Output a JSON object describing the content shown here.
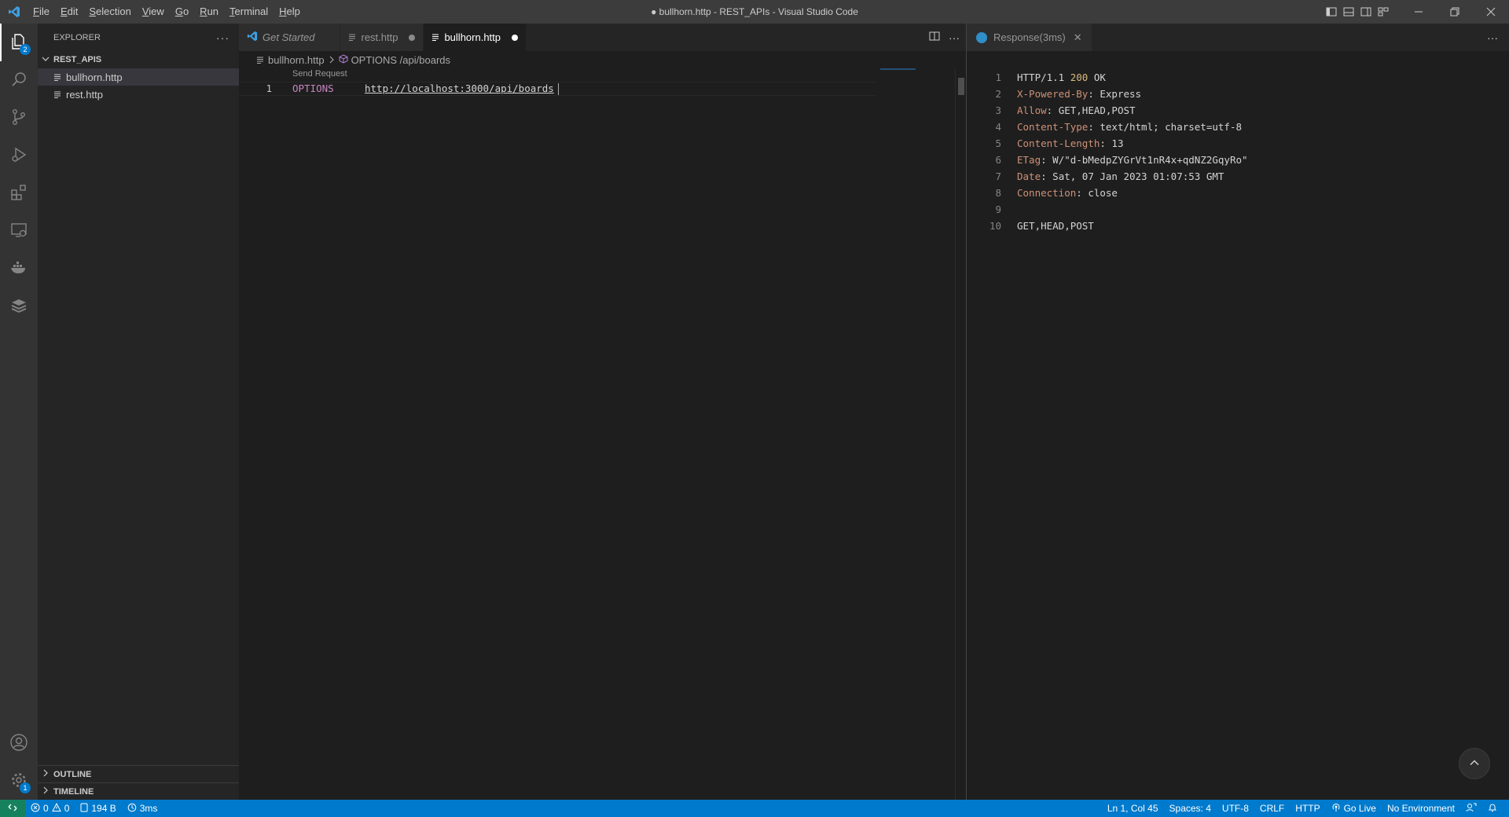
{
  "window": {
    "title": "● bullhorn.http - REST_APIs - Visual Studio Code"
  },
  "menu": [
    "File",
    "Edit",
    "Selection",
    "View",
    "Go",
    "Run",
    "Terminal",
    "Help"
  ],
  "activity": {
    "explorer_badge": "2",
    "settings_badge": "1"
  },
  "sidebar": {
    "header": "EXPLORER",
    "more": "···",
    "folder": "REST_APIS",
    "files": [
      {
        "name": "bullhorn.http",
        "selected": true
      },
      {
        "name": "rest.http",
        "selected": false
      }
    ],
    "outline": "OUTLINE",
    "timeline": "TIMELINE"
  },
  "editor": {
    "tabs": [
      {
        "label": "Get Started",
        "italic": true
      },
      {
        "label": "rest.http",
        "dirty": true
      },
      {
        "label": "bullhorn.http",
        "dirty": true,
        "active": true
      }
    ],
    "breadcrumb": {
      "file": "bullhorn.http",
      "symbol": "OPTIONS /api/boards"
    },
    "codelens": "Send Request",
    "line_number": "1",
    "method": "OPTIONS",
    "url": "http://localhost:3000/api/boards"
  },
  "response": {
    "tab_label": "Response(3ms)",
    "lines": [
      {
        "n": "1",
        "key": "HTTP/1.1 ",
        "status": "200",
        "rest": " OK"
      },
      {
        "n": "2",
        "key": "X-Powered-By",
        "value": "Express"
      },
      {
        "n": "3",
        "key": "Allow",
        "value": "GET,HEAD,POST"
      },
      {
        "n": "4",
        "key": "Content-Type",
        "value": "text/html; charset=utf-8"
      },
      {
        "n": "5",
        "key": "Content-Length",
        "value": "13"
      },
      {
        "n": "6",
        "key": "ETag",
        "value": "W/\"d-bMedpZYGrVt1nR4x+qdNZ2GqyRo\""
      },
      {
        "n": "7",
        "key": "Date",
        "value": "Sat, 07 Jan 2023 01:07:53 GMT"
      },
      {
        "n": "8",
        "key": "Connection",
        "value": "close"
      },
      {
        "n": "9",
        "body": ""
      },
      {
        "n": "10",
        "body": "GET,HEAD,POST"
      }
    ]
  },
  "status": {
    "errors": "0",
    "warnings": "0",
    "size": "194 B",
    "time": "3ms",
    "position": "Ln 1, Col 45",
    "spaces": "Spaces: 4",
    "encoding": "UTF-8",
    "eol": "CRLF",
    "language": "HTTP",
    "go_live": "Go Live",
    "environment": "No Environment"
  },
  "colors": {
    "accent": "#007acc",
    "remote": "#16825d",
    "method": "#c586c0",
    "header_key": "#ce9178"
  }
}
